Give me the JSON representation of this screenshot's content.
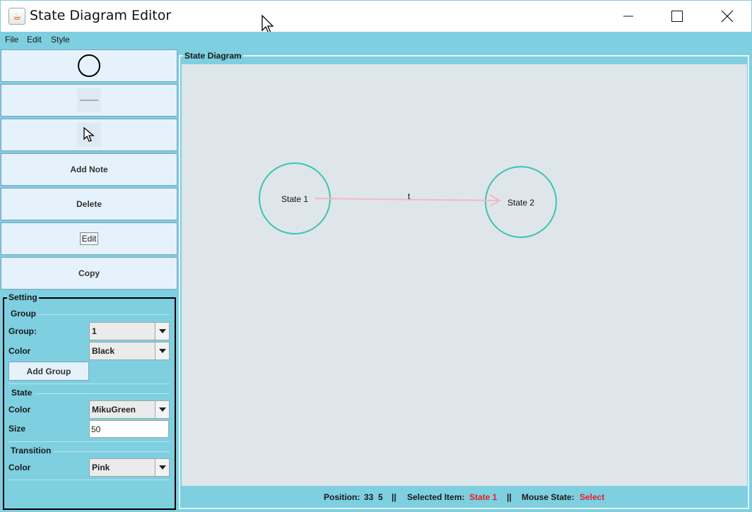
{
  "window": {
    "title": "State Diagram Editor"
  },
  "menu": [
    "File",
    "Edit",
    "Style"
  ],
  "toolbar": {
    "circle_tool_icon": "circle-icon",
    "line_tool_icon": "line-icon",
    "select_tool_icon": "arrow-cursor-icon",
    "add_note_label": "Add Note",
    "delete_label": "Delete",
    "edit_label": "Edit",
    "copy_label": "Copy"
  },
  "setting": {
    "title": "Setting",
    "group": {
      "heading": "Group",
      "group_label": "Group:",
      "group_value": "1",
      "color_label": "Color",
      "color_value": "Black",
      "add_group_label": "Add Group"
    },
    "state": {
      "heading": "State",
      "color_label": "Color",
      "color_value": "MikuGreen",
      "size_label": "Size",
      "size_value": "50"
    },
    "transition": {
      "heading": "Transition",
      "color_label": "Color",
      "color_value": "Pink"
    }
  },
  "diagram": {
    "title": "State Diagram",
    "states": [
      {
        "label": "State 1"
      },
      {
        "label": "State 2"
      }
    ],
    "transition": {
      "label": "t"
    },
    "colors": {
      "state_stroke": "#3cc4b4",
      "transition_stroke": "#f4b8c4",
      "canvas": "#dee6ea"
    }
  },
  "status": {
    "position_label": "Position:",
    "position_value": "33  5",
    "sep1": "||",
    "selected_label": "Selected Item:",
    "selected_value": "State 1",
    "sep2": "||",
    "mouse_label": "Mouse State:",
    "mouse_value": "Select"
  },
  "colors": {
    "panel_bg": "#7ecfe0",
    "button_bg": "#e6f2fb",
    "status_highlight": "#e0202a"
  }
}
